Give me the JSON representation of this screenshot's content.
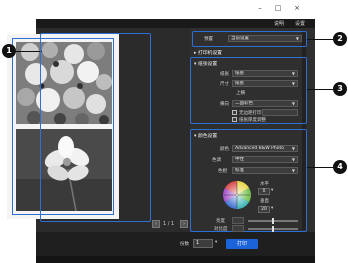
{
  "window": {
    "minimize_icon": "minimize-icon",
    "maximize_icon": "maximize-icon",
    "close_icon": "close-icon"
  },
  "menubar": {
    "item1": "说明",
    "item2": "设置"
  },
  "preset": {
    "label": "预置",
    "value": "当前设置"
  },
  "sections": {
    "print_preset": "打印机设置",
    "paper": "纸张设置",
    "color": "颜色设置"
  },
  "paper_settings": {
    "source_label": "纸张",
    "source_value": "纸张",
    "size_label": "尺寸",
    "size_value": "纸张",
    "orientation_value": "上横",
    "type_label": "横向",
    "type_value": "二面彩色",
    "borderless_label": "无边距打印",
    "check2_label": "纸张厚度调整"
  },
  "color_settings": {
    "mode_label": "颜色",
    "mode_value": "Advanced B&W Photo",
    "tone_label": "色调",
    "tone_value": "中性",
    "type_label": "色相",
    "type_value": "标准",
    "horizontal_label": "水平",
    "horizontal_value": "0",
    "vertical_label": "垂直",
    "vertical_value": "20",
    "brightness_label": "亮度",
    "contrast_label": "对比度"
  },
  "pager": {
    "page": "1 / 1"
  },
  "bottom": {
    "copies_label": "份数",
    "copies_value": "1",
    "print_button": "打印"
  },
  "callouts": [
    "1",
    "2",
    "3",
    "4"
  ],
  "colors": {
    "accent": "#2d6fd6",
    "print_button": "#1b63d9",
    "panel": "#2f2f2f"
  }
}
